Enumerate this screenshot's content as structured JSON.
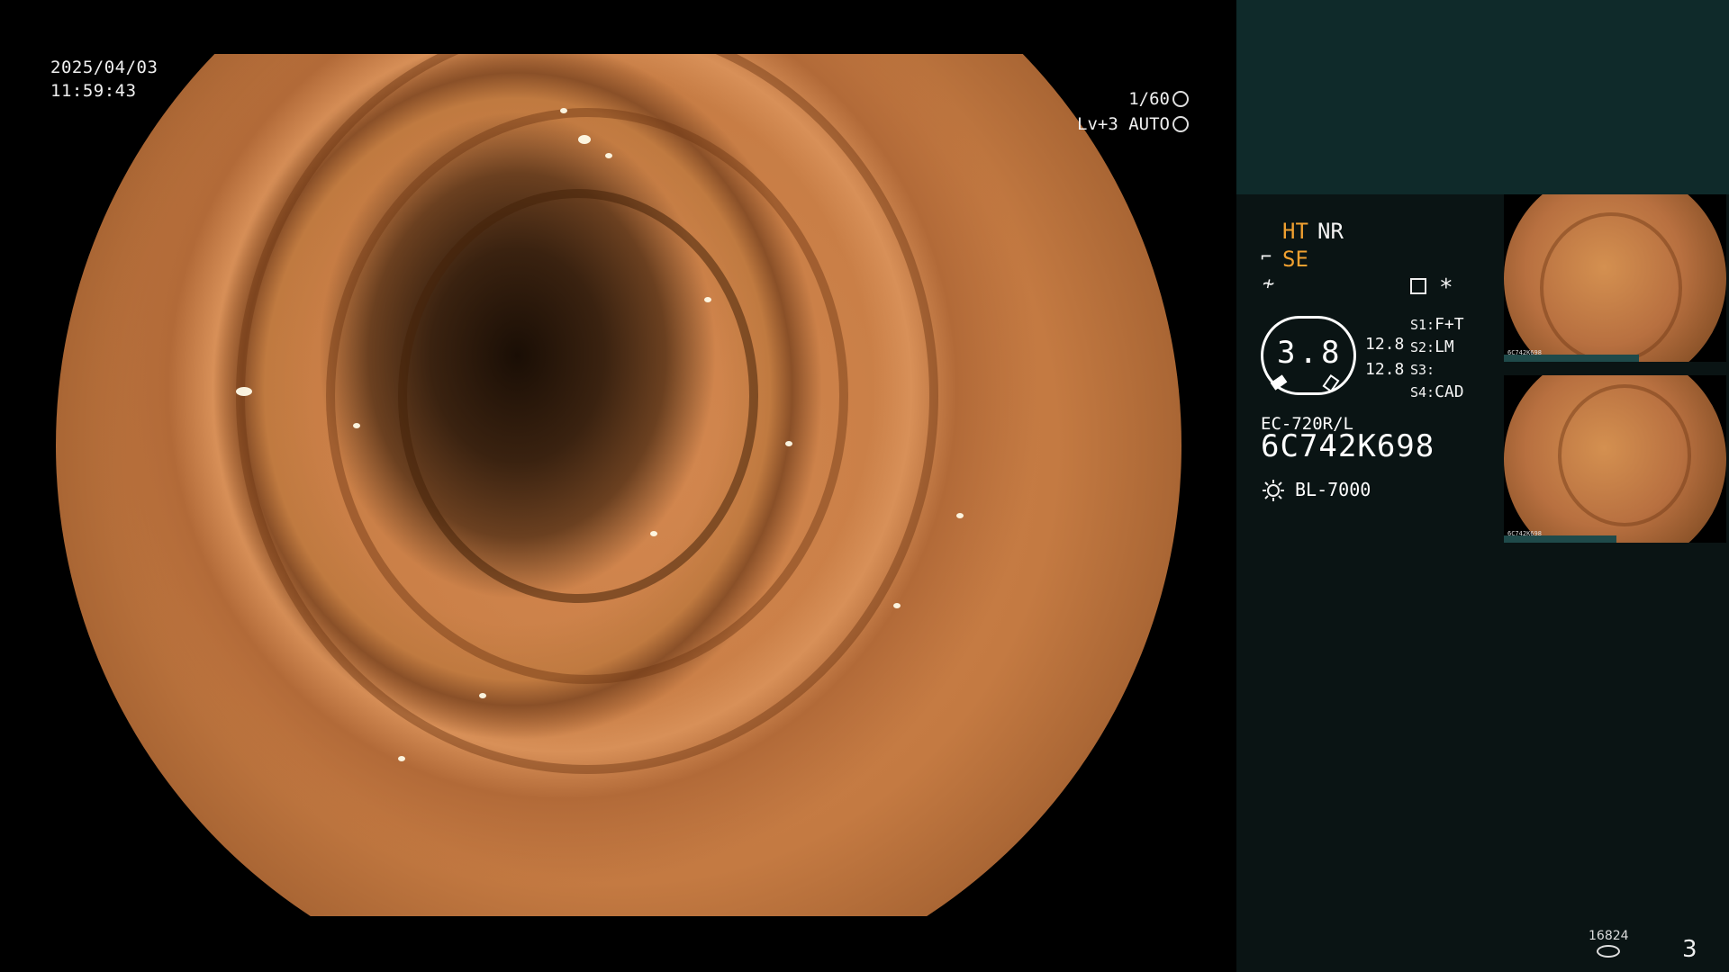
{
  "datetime": {
    "date": "2025/04/03",
    "time": "11:59:43"
  },
  "shutter": {
    "speed": "1/60",
    "level": "Lv+3 AUTO"
  },
  "modes": {
    "ht": "HT",
    "nr": "NR",
    "se": "SE"
  },
  "gauge": {
    "value": "3.8",
    "top": "12.8",
    "bottom": "12.8"
  },
  "switches": [
    {
      "key": "S1:",
      "value": "F+T"
    },
    {
      "key": "S2:",
      "value": "LM"
    },
    {
      "key": "S3:",
      "value": ""
    },
    {
      "key": "S4:",
      "value": "CAD"
    }
  ],
  "scope": {
    "model": "EC-720R/L",
    "serial": "6C742K698",
    "light_source": "BL-7000"
  },
  "icons": [
    "shutter-icon",
    "auto-iris-icon",
    "enhance-icon",
    "freeze-icon",
    "settings-icon",
    "asterisk-icon",
    "light-source-icon",
    "storage-icon"
  ],
  "thumbnails": [
    {
      "label": "6C742K698"
    },
    {
      "label": "6C742K698"
    }
  ],
  "storage": {
    "count": "16824"
  },
  "page_number": "3",
  "colors": {
    "mode_accent": "#f0a030",
    "panel_bg": "#0a1414",
    "panel_top": "#0f2a2a"
  }
}
